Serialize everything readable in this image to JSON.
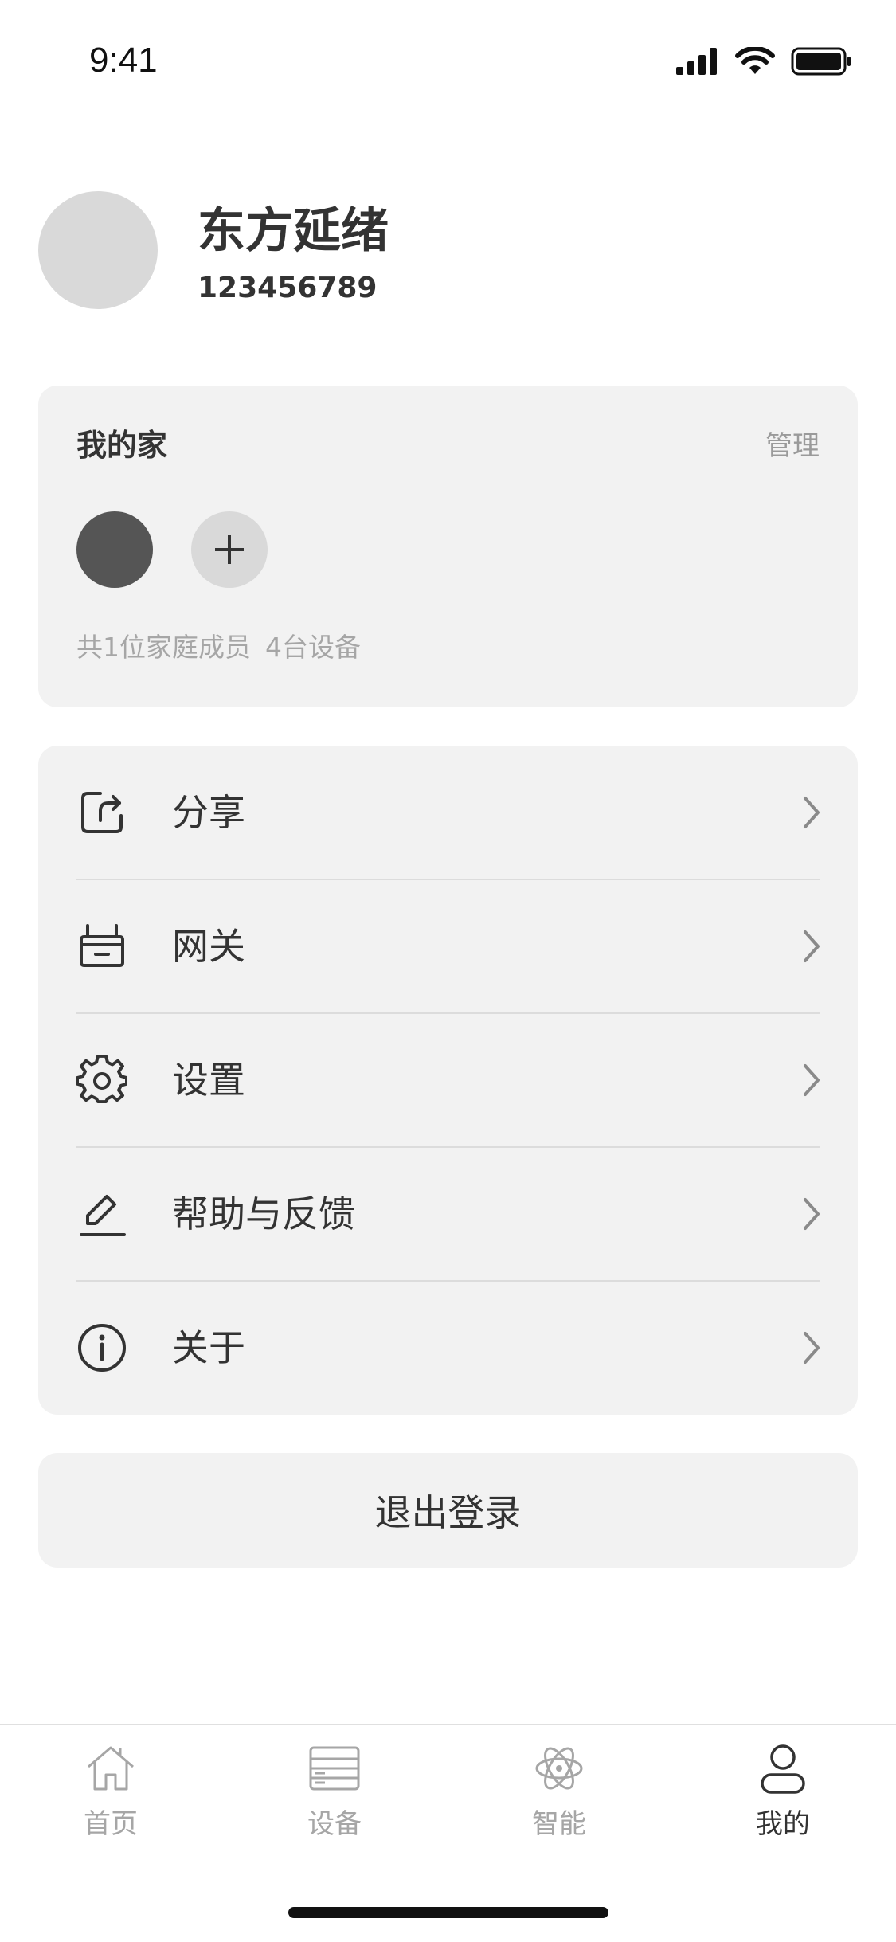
{
  "status_bar": {
    "time": "9:41"
  },
  "profile": {
    "name": "东方延绪",
    "id": "123456789"
  },
  "home": {
    "title": "我的家",
    "manage_label": "管理",
    "members_text": "共1位家庭成员",
    "devices_text": "4台设备"
  },
  "menu": {
    "items": [
      {
        "label": "分享",
        "icon": "share-icon"
      },
      {
        "label": "网关",
        "icon": "gateway-icon"
      },
      {
        "label": "设置",
        "icon": "gear-icon"
      },
      {
        "label": "帮助与反馈",
        "icon": "edit-icon"
      },
      {
        "label": "关于",
        "icon": "info-icon"
      }
    ]
  },
  "logout_label": "退出登录",
  "tabbar": {
    "tabs": [
      {
        "label": "首页",
        "icon": "home-icon",
        "active": false
      },
      {
        "label": "设备",
        "icon": "devices-icon",
        "active": false
      },
      {
        "label": "智能",
        "icon": "atom-icon",
        "active": false
      },
      {
        "label": "我的",
        "icon": "user-icon",
        "active": true
      }
    ]
  },
  "colors": {
    "card_bg": "#f2f2f2",
    "text_primary": "#333333",
    "text_secondary": "#a6a6a6",
    "avatar_bg": "#d9d9d9",
    "member_dot": "#555555"
  }
}
